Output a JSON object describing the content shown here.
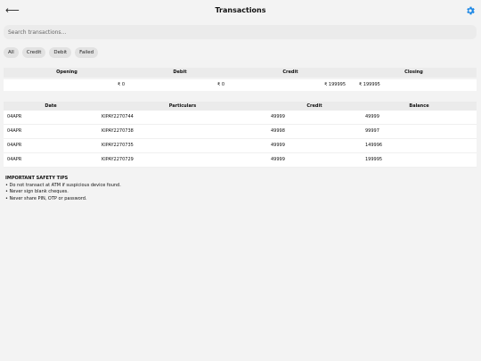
{
  "header": {
    "title": "Transactions"
  },
  "search": {
    "placeholder": "Search transactions..."
  },
  "filters": [
    "All",
    "Credit",
    "Debit",
    "Failed"
  ],
  "summary": {
    "headers": [
      "Opening",
      "Debit",
      "Credit",
      "Closing"
    ],
    "values": [
      "₹ 0",
      "₹ 0",
      "₹ 199995",
      "₹ 199995"
    ]
  },
  "transactions": {
    "headers": [
      "Date",
      "Particulars",
      "Credit",
      "Balance"
    ],
    "rows": [
      [
        "04APR",
        "KIPAY2270744",
        "49999",
        "49999"
      ],
      [
        "04APR",
        "KIPAY2270738",
        "49998",
        "99997"
      ],
      [
        "04APR",
        "KIPAY2270735",
        "49999",
        "149996"
      ],
      [
        "04APR",
        "KIPAY2270729",
        "49999",
        "199995"
      ]
    ]
  },
  "tips": {
    "title": "IMPORTANT SAFETY TIPS",
    "items": [
      "Do not transact at ATM if suspicious device found.",
      "Never sign blank cheques.",
      "Never share PIN, OTP or password."
    ]
  },
  "icons": {
    "back": "back-arrow-icon",
    "settings": "gear-icon"
  },
  "colors": {
    "accent": "#1e88e5",
    "background": "#f3f3f3"
  }
}
